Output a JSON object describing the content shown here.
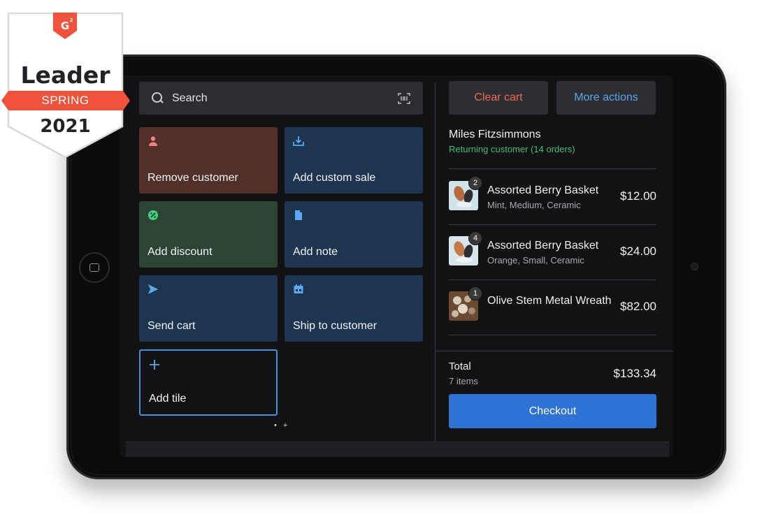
{
  "badge": {
    "logo": "G2",
    "title": "Leader",
    "season": "SPRING",
    "year": "2021",
    "colors": {
      "accent": "#f1523b"
    }
  },
  "search": {
    "placeholder": "Search",
    "icon": "search-icon",
    "scan_icon": "barcode-scan-icon"
  },
  "tiles": [
    {
      "label": "Remove customer",
      "icon": "person-icon",
      "color": "#503028"
    },
    {
      "label": "Add custom sale",
      "icon": "tray-add-icon",
      "color": "#1d3550"
    },
    {
      "label": "Add discount",
      "icon": "discount-icon",
      "color": "#2b4434"
    },
    {
      "label": "Add note",
      "icon": "document-icon",
      "color": "#1d3550"
    },
    {
      "label": "Send cart",
      "icon": "send-icon",
      "color": "#1d3550"
    },
    {
      "label": "Ship to customer",
      "icon": "calendar-box-icon",
      "color": "#1d3550"
    },
    {
      "label": "Add tile",
      "icon": "plus-icon",
      "color": "#121214"
    }
  ],
  "pager": {
    "dots": "• +"
  },
  "actions": {
    "clear": "Clear cart",
    "more": "More actions"
  },
  "customer": {
    "name": "Miles Fitzsimmons",
    "status": "Returning customer (14 orders)"
  },
  "cart": [
    {
      "qty": "2",
      "name": "Assorted Berry Basket",
      "variant": "Mint, Medium, Ceramic",
      "price": "$12.00"
    },
    {
      "qty": "4",
      "name": "Assorted Berry Basket",
      "variant": "Orange, Small, Ceramic",
      "price": "$24.00"
    },
    {
      "qty": "1",
      "name": "Olive Stem Metal Wreath",
      "variant": "",
      "price": "$82.00"
    }
  ],
  "summary": {
    "label": "Total",
    "count": "7 items",
    "amount": "$133.34"
  },
  "checkout": {
    "label": "Checkout"
  },
  "colors": {
    "danger": "#ef6a53",
    "link": "#58a6ee",
    "success": "#3fbf75",
    "primary": "#2d72d4"
  }
}
